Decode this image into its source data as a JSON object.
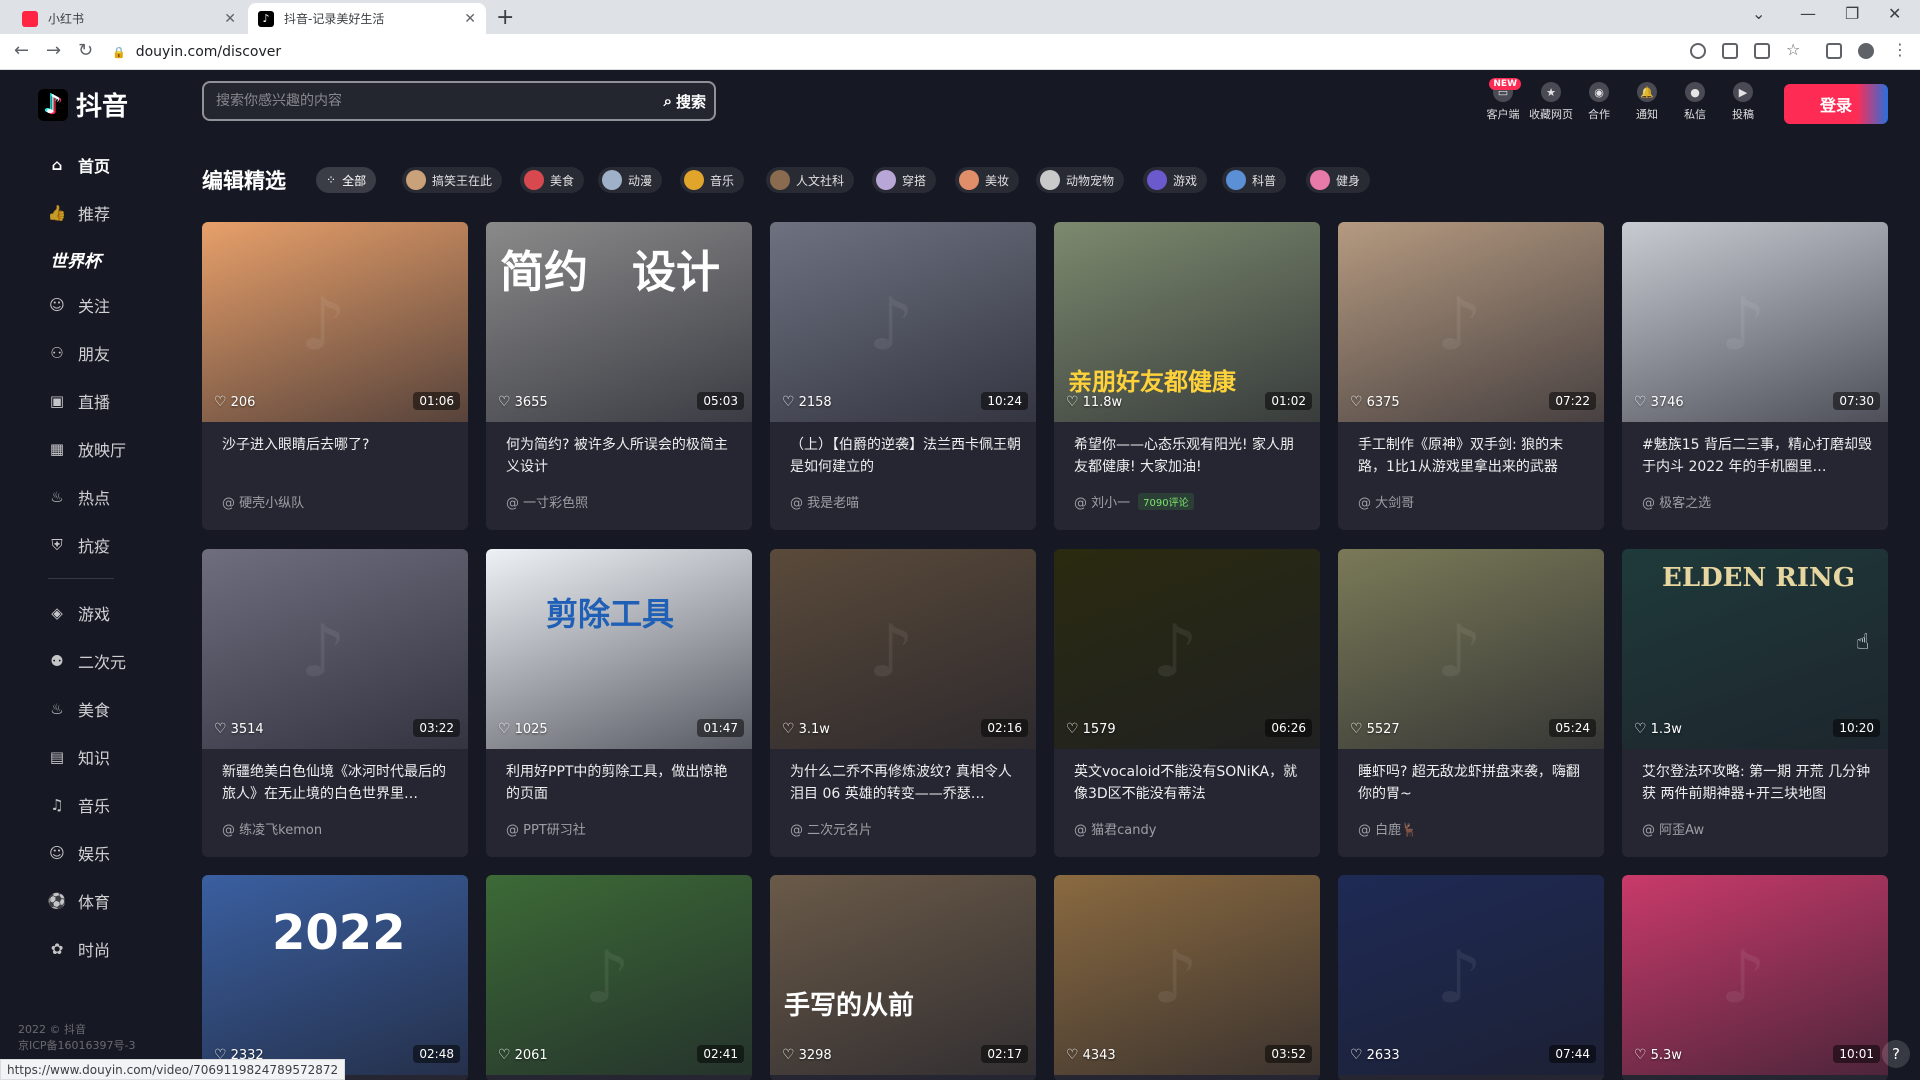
{
  "browser": {
    "tabs": [
      {
        "title": "小红书",
        "active": false
      },
      {
        "title": "抖音-记录美好生活",
        "active": true
      }
    ],
    "new_tab": "+",
    "url": "douyin.com/discover",
    "status_url": "https://www.douyin.com/video/7069119824789572872"
  },
  "app": {
    "logo_text": "抖音",
    "search_placeholder": "搜索你感兴趣的内容",
    "search_button": "搜索",
    "header_buttons": [
      {
        "label": "客户端",
        "icon": "desktop-icon",
        "badge": "NEW"
      },
      {
        "label": "收藏网页",
        "icon": "star-icon"
      },
      {
        "label": "合作",
        "icon": "handshake-icon"
      },
      {
        "label": "通知",
        "icon": "bell-icon"
      },
      {
        "label": "私信",
        "icon": "message-icon"
      },
      {
        "label": "投稿",
        "icon": "upload-icon"
      }
    ],
    "login_button": "登录"
  },
  "sidebar": {
    "items": [
      {
        "label": "首页",
        "icon": "home-icon",
        "active": true
      },
      {
        "label": "推荐",
        "icon": "thumbs-up-icon"
      },
      {
        "label": "世界杯",
        "icon": "",
        "special": true
      },
      {
        "label": "关注",
        "icon": "user-icon"
      },
      {
        "label": "朋友",
        "icon": "friends-icon"
      },
      {
        "label": "直播",
        "icon": "live-icon"
      },
      {
        "label": "放映厅",
        "icon": "calendar-icon"
      },
      {
        "label": "热点",
        "icon": "flame-icon"
      },
      {
        "label": "抗疫",
        "icon": "shield-icon"
      },
      {
        "label": "游戏",
        "icon": "gamepad-icon"
      },
      {
        "label": "二次元",
        "icon": "anime-icon"
      },
      {
        "label": "美食",
        "icon": "food-icon"
      },
      {
        "label": "知识",
        "icon": "book-icon"
      },
      {
        "label": "音乐",
        "icon": "music-icon"
      },
      {
        "label": "娱乐",
        "icon": "smile-icon"
      },
      {
        "label": "体育",
        "icon": "ball-icon"
      },
      {
        "label": "时尚",
        "icon": "fashion-icon"
      }
    ],
    "copyright_line1": "2022 © 抖音",
    "copyright_line2": "京ICP备16016397号-3"
  },
  "categories": {
    "title": "编辑精选",
    "chips": [
      {
        "label": "全部",
        "active": true
      },
      {
        "label": "搞笑王在此",
        "color": "#c9a27a"
      },
      {
        "label": "美食",
        "color": "#d8484f"
      },
      {
        "label": "动漫",
        "color": "#9fb0c9"
      },
      {
        "label": "音乐",
        "color": "#e0a52a"
      },
      {
        "label": "人文社科",
        "color": "#8a6b4f"
      },
      {
        "label": "穿搭",
        "color": "#b8a7d6"
      },
      {
        "label": "美妆",
        "color": "#e08d6a"
      },
      {
        "label": "动物宠物",
        "color": "#c9c9c9"
      },
      {
        "label": "游戏",
        "color": "#6a5acd"
      },
      {
        "label": "科普",
        "color": "#5b8fd6"
      },
      {
        "label": "健身",
        "color": "#e77aa9"
      }
    ]
  },
  "videos": [
    {
      "likes": "206",
      "duration": "01:06",
      "title": "沙子进入眼睛后去哪了?",
      "author": "@ 硬壳小纵队",
      "thumb": "#e8a06a",
      "overlay": ""
    },
    {
      "likes": "3655",
      "duration": "05:03",
      "title": "何为简约? 被许多人所误会的极简主义设计",
      "author": "@ 一寸彩色照",
      "thumb": "#8a8a8a",
      "overlay": "简约　设计"
    },
    {
      "likes": "2158",
      "duration": "10:24",
      "title": "（上）【伯爵的逆袭】法兰西卡佩王朝是如何建立的",
      "author": "@ 我是老喵",
      "thumb": "#6e7280",
      "overlay": ""
    },
    {
      "likes": "11.8w",
      "duration": "01:02",
      "title": "希望你——心态乐观有阳光! 家人朋友都健康! 大家加油!",
      "author": "@ 刘小一",
      "tag": "7090评论",
      "thumb": "#7d8a6e",
      "overlay": "亲朋好友都健康"
    },
    {
      "likes": "6375",
      "duration": "07:22",
      "title": "手工制作《原神》双手剑: 狼的末路，1比1从游戏里拿出来的武器",
      "author": "@ 大剑哥",
      "thumb": "#b59a80",
      "overlay": ""
    },
    {
      "likes": "3746",
      "duration": "07:30",
      "title": "#魅族15 背后二三事，精心打磨却毁于内斗 2022 年的手机圈里…",
      "author": "@ 极客之选",
      "thumb": "#c8ccd2",
      "overlay": ""
    },
    {
      "likes": "3514",
      "duration": "03:22",
      "title": "新疆绝美白色仙境《冰河时代最后的旅人》在无止境的白色世界里…",
      "author": "@ 练凌飞kemon",
      "thumb": "#6e6e7e",
      "overlay": ""
    },
    {
      "likes": "1025",
      "duration": "01:47",
      "title": "利用好PPT中的剪除工具，做出惊艳的页面",
      "author": "@ PPT研习社",
      "thumb": "#eef2f6",
      "overlay": "剪除工具"
    },
    {
      "likes": "3.1w",
      "duration": "02:16",
      "title": "为什么二乔不再修炼波纹? 真相令人泪目 06 英雄的转变——乔瑟…",
      "author": "@ 二次元名片",
      "thumb": "#5a4a3a",
      "overlay": ""
    },
    {
      "likes": "1579",
      "duration": "06:26",
      "title": "英文vocaloid不能没有SONiKA，就像3D区不能没有蒂法",
      "author": "@ 猫君candy",
      "thumb": "#2a2a10",
      "overlay": ""
    },
    {
      "likes": "5527",
      "duration": "05:24",
      "title": "睡虾吗? 超无敌龙虾拼盘来袭，嗨翻你的胃~",
      "author": "@ 白鹿🦌",
      "thumb": "#7a7a58",
      "overlay": ""
    },
    {
      "likes": "1.3w",
      "duration": "10:20",
      "title": "艾尔登法环攻略: 第一期 开荒 几分钟获 两件前期神器+开三块地图",
      "author": "@ 阿歪Aw",
      "thumb": "#1f3a3a",
      "overlay": "ELDEN RING"
    },
    {
      "likes": "2332",
      "duration": "02:48",
      "title": "",
      "author": "",
      "thumb": "#3a5fa0",
      "overlay": "2022"
    },
    {
      "likes": "2061",
      "duration": "02:41",
      "title": "",
      "author": "",
      "thumb": "#3c6a36",
      "overlay": ""
    },
    {
      "likes": "3298",
      "duration": "02:17",
      "title": "",
      "author": "",
      "thumb": "#6a5a48",
      "overlay": "手写的从前"
    },
    {
      "likes": "4343",
      "duration": "03:52",
      "title": "",
      "author": "",
      "thumb": "#8a6a40",
      "overlay": ""
    },
    {
      "likes": "2633",
      "duration": "07:44",
      "title": "",
      "author": "",
      "thumb": "#1e2a55",
      "overlay": ""
    },
    {
      "likes": "5.3w",
      "duration": "10:01",
      "title": "",
      "author": "",
      "thumb": "#c93a6a",
      "overlay": ""
    }
  ]
}
